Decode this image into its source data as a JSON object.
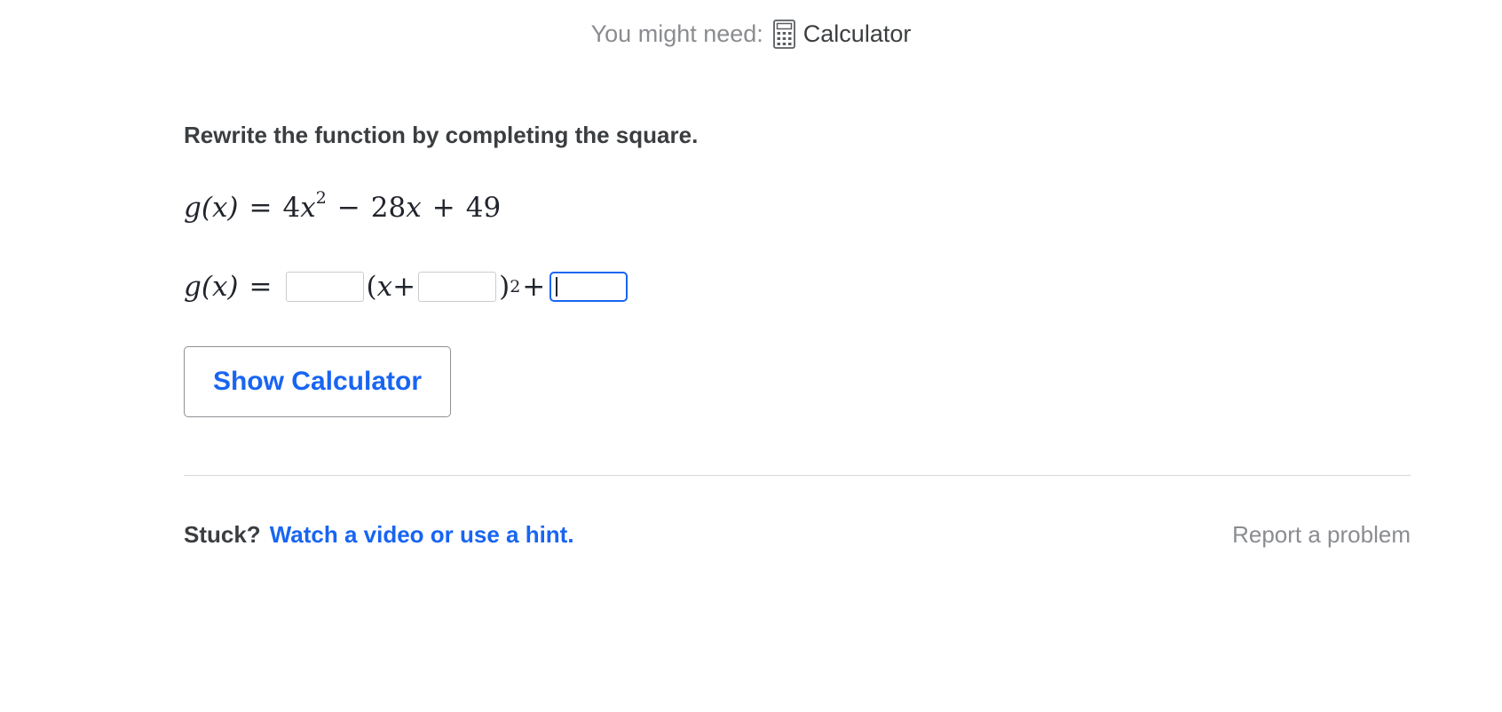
{
  "header": {
    "need_label": "You might need:",
    "tool_icon": "calculator-icon",
    "tool_name": "Calculator"
  },
  "question": {
    "prompt": "Rewrite the function by completing the square.",
    "given": {
      "lhs": "g(x)",
      "eq": "=",
      "coef": "4",
      "var": "x",
      "exp": "2",
      "minus": "−",
      "term2": "28",
      "plus": "+",
      "const": "49"
    },
    "answer": {
      "lhs": "g(x)",
      "eq": "=",
      "open": "(",
      "var": "x",
      "plus_inner": "+",
      "close": ")",
      "exp": "2",
      "plus_outer": "+",
      "box_values": [
        "",
        "",
        ""
      ],
      "focused_box": 3
    }
  },
  "buttons": {
    "show_calculator": "Show Calculator"
  },
  "footer": {
    "stuck_label": "Stuck?",
    "hint_link": "Watch a video or use a hint.",
    "report_link": "Report a problem"
  },
  "colors": {
    "link": "#1865f2",
    "muted": "#8a8c90",
    "text": "#3b3e40",
    "focus_border": "#1865f2"
  }
}
